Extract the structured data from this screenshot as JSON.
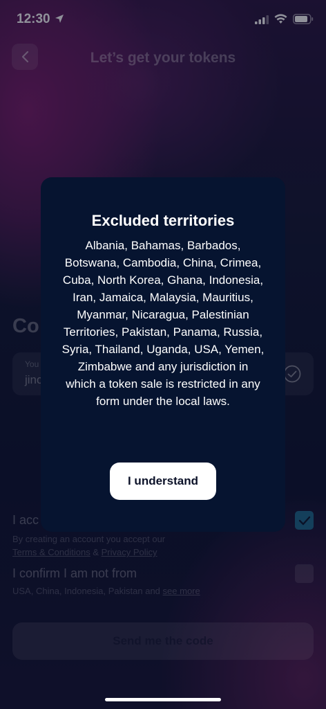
{
  "status_bar": {
    "time": "12:30"
  },
  "header": {
    "title": "Let’s get your tokens"
  },
  "background": {
    "heading": "Co",
    "field": {
      "label": "You",
      "value": "jinc"
    },
    "accept": {
      "label": "I acc",
      "sub_prefix": "By creating an account you accept our",
      "terms_link": "Terms & Conditions",
      "amp": "&",
      "privacy_link": "Privacy Policy"
    },
    "confirm": {
      "label": "I confirm I am not from",
      "sub_prefix": "USA, China, Indonesia, Pakistan and",
      "see_more": "see more"
    },
    "send_button": "Send me the code"
  },
  "modal": {
    "title": "Excluded territories",
    "body": "Albania, Bahamas, Barbados, Botswana, Cambodia, China, Crimea, Cuba, North Korea, Ghana, Indonesia, Iran, Jamaica, Malaysia, Mauritius, Myanmar, Nicaragua, Palestinian Territories, Pakistan, Panama, Russia, Syria, Thailand, Uganda, USA, Yemen, Zimbabwe and any jurisdiction in which a token sale is restricted in any form under the local laws.",
    "button": "I understand"
  },
  "colors": {
    "accent_checkbox": "#1e6a8c",
    "modal_bg": "#061430"
  }
}
